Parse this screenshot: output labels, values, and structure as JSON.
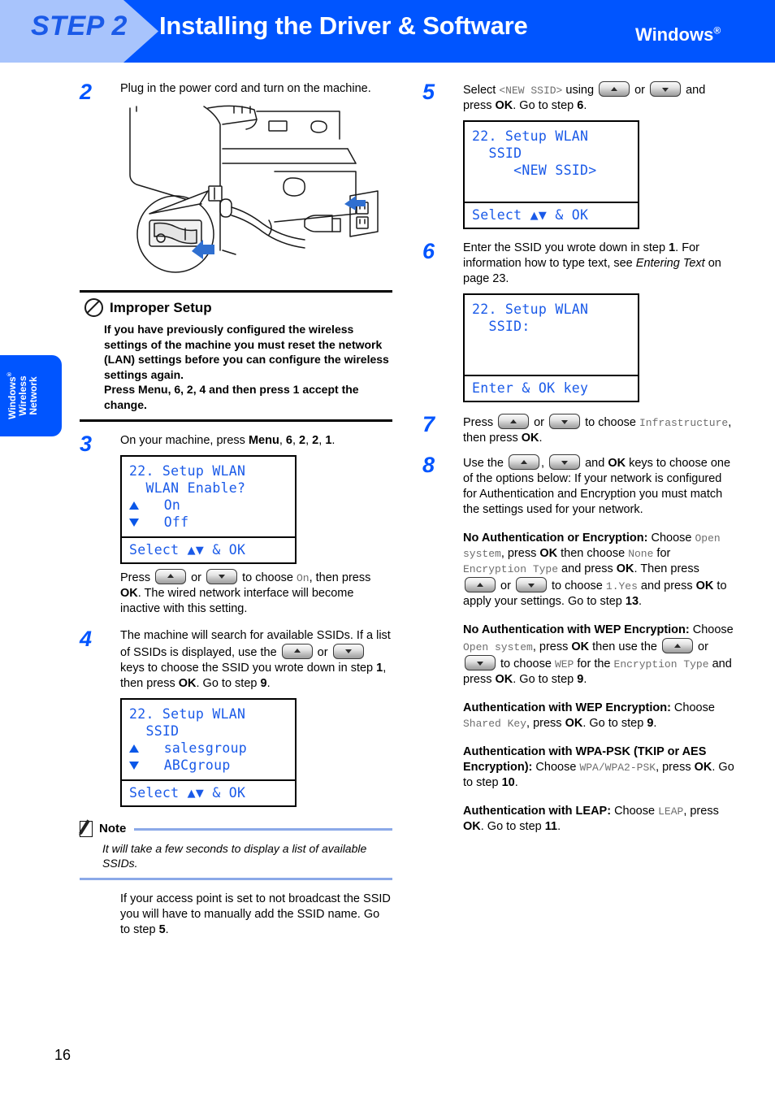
{
  "header": {
    "step_label": "STEP 2",
    "title": "Installing the Driver & Software",
    "os_label": "Windows",
    "os_sup": "®",
    "bg_color": "#0055ff",
    "step_bg_color": "#a8c4fc",
    "step_text_color": "#1a5ae8"
  },
  "sidetab": {
    "line1": "Windows",
    "line1_sup": "®",
    "line2": "Wireless",
    "line3": "Network",
    "color": "#0055ff"
  },
  "page_number": "16",
  "left_column": {
    "step2": {
      "number": "2",
      "text": "Plug in the power cord and turn on the machine.",
      "illustration_name": "printer-power-cord-illustration"
    },
    "improper_setup": {
      "icon": "prohibition-icon",
      "title": "Improper Setup",
      "body_line1": "If you have previously configured the wireless settings of the machine you must reset the network (LAN) settings before you can configure the wireless settings again.",
      "body_line2": "Press Menu, 6, 2, 4 and then press 1 accept the change."
    },
    "step3": {
      "number": "3",
      "text_prefix": "On your machine, press ",
      "text_bold_menu": "Menu",
      "keys": [
        "6",
        "2",
        "2",
        "1"
      ],
      "lcd": {
        "line1": "22. Setup WLAN",
        "line2": "  WLAN Enable?",
        "line3_arrow": "up",
        "line3": "On",
        "line4_arrow": "down",
        "line4": "Off",
        "footer": "Select ▲▼ & OK"
      },
      "after_lcd": {
        "p1a": "Press ",
        "p1_key1": "up-arrow-key",
        "p1b": " or ",
        "p1_key2": "down-arrow-key",
        "p1c": " to choose ",
        "p1_mono": "On",
        "p1d": ", then press ",
        "p1_bold": "OK",
        "p1e": ". The wired network interface will become inactive with this setting."
      }
    },
    "step4": {
      "number": "4",
      "t1": "The machine will search for available SSIDs. If a list of SSIDs is displayed, use the ",
      "t2": " or ",
      "t3": " keys to choose the SSID you wrote down in step ",
      "b1": "1",
      "t4": ", then press ",
      "b2": "OK",
      "t5": ". Go to step ",
      "b3": "9",
      "t6": ".",
      "lcd": {
        "line1": "22. Setup WLAN",
        "line2": "  SSID",
        "line3_arrow": "up",
        "line3": "salesgroup",
        "line4_arrow": "down",
        "line4": "ABCgroup",
        "footer": "Select ▲▼ & OK"
      }
    },
    "note": {
      "icon": "note-pencil-icon",
      "title": "Note",
      "body": "It will take a few seconds to display a list of available SSIDs."
    },
    "after_note": {
      "t1": "If your access point is set to not broadcast the SSID you will have to manually add the SSID name. Go to step ",
      "b1": "5",
      "t2": "."
    }
  },
  "right_column": {
    "step5": {
      "number": "5",
      "t1": "Select ",
      "m1": "<NEW SSID>",
      "t2": " using ",
      "t3": " or ",
      "t4": " and press ",
      "b1": "OK",
      "t5": ". Go to step ",
      "b2": "6",
      "t6": ".",
      "lcd": {
        "line1": "22. Setup WLAN",
        "line2": "  SSID",
        "line3": "     <NEW SSID>",
        "line4": "",
        "footer": "Select ▲▼ & OK"
      }
    },
    "step6": {
      "number": "6",
      "t1": "Enter the SSID you wrote down in step ",
      "b1": "1",
      "t2": ". For information how to type text, see ",
      "i1": "Entering Text",
      "t3": " on page 23.",
      "lcd": {
        "line1": "22. Setup WLAN",
        "line2": "  SSID:",
        "line3": "",
        "line4": "",
        "footer": "Enter & OK key"
      }
    },
    "step7": {
      "number": "7",
      "t1": "Press ",
      "t2": " or ",
      "t3": " to choose ",
      "m1": "Infrastructure",
      "t4": ", then press ",
      "b1": "OK",
      "t5": "."
    },
    "step8": {
      "number": "8",
      "t1": "Use the ",
      "t2": ", ",
      "t3": " and ",
      "b1": "OK",
      "t4": " keys to choose one of the options below: If your network is configured for Authentication and Encryption you must match the settings used for your network."
    },
    "auth_options": [
      {
        "id": "no-auth-no-encryption",
        "title": "No Authentication or Encryption:",
        "t1": " Choose ",
        "m1": "Open system",
        "t2": ", press ",
        "b1": "OK",
        "t3": " then choose ",
        "m2": "None",
        "t4": " for ",
        "m3": "Encryption Type",
        "t5": " and press ",
        "b2": "OK",
        "t6": ". Then press ",
        "t7": " or ",
        "t8": " to choose ",
        "m4": "1.Yes",
        "t9": " and press ",
        "b3": "OK",
        "t10": " to apply your settings. Go to step ",
        "b4": "13",
        "t11": "."
      },
      {
        "id": "no-auth-wep",
        "title": "No Authentication with WEP Encryption:",
        "t1": " Choose ",
        "m1": "Open system",
        "t2": ", press ",
        "b1": "OK",
        "t3": " then use the ",
        "t4": " or ",
        "t5": " to choose ",
        "m2": "WEP",
        "t6": " for the ",
        "m3": "Encryption Type",
        "t7": " and press ",
        "b2": "OK",
        "t8": ". Go to step ",
        "b3": "9",
        "t9": "."
      },
      {
        "id": "auth-wep",
        "title": "Authentication with WEP Encryption:",
        "t1": " Choose ",
        "m1": "Shared Key",
        "t2": ", press ",
        "b1": "OK",
        "t3": ". Go to step ",
        "b2": "9",
        "t4": "."
      },
      {
        "id": "auth-wpa-psk",
        "title": "Authentication with WPA-PSK (TKIP or AES Encryption):",
        "t1": " Choose ",
        "m1": "WPA/WPA2-PSK",
        "t2": ", press ",
        "b1": "OK",
        "t3": ". Go to step ",
        "b2": "10",
        "t4": "."
      },
      {
        "id": "auth-leap",
        "title": "Authentication with LEAP:",
        "t1": " Choose ",
        "m1": "LEAP",
        "t2": ", press ",
        "b1": "OK",
        "t3": ". Go to step ",
        "b2": "11",
        "t4": "."
      }
    ]
  }
}
